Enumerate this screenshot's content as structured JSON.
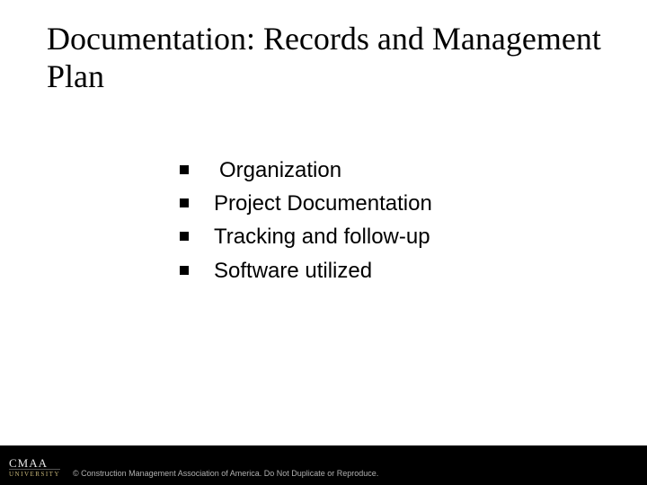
{
  "title": "Documentation: Records and Management Plan",
  "bullets": [
    {
      "text": "Organization"
    },
    {
      "text": "Project Documentation"
    },
    {
      "text": "Tracking and follow-up"
    },
    {
      "text": "Software utilized"
    }
  ],
  "footer": {
    "logo_top": "CMAA",
    "logo_bottom": "UNIVERSITY",
    "copyright": "© Construction Management Association of America. Do Not Duplicate or Reproduce."
  }
}
